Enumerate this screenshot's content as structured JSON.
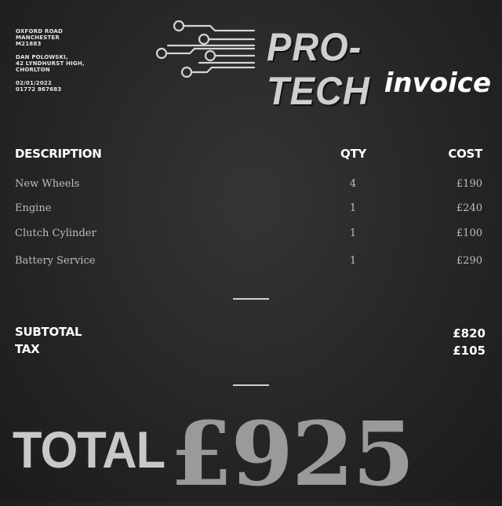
{
  "address": {
    "company": [
      "OXFORD ROAD",
      "MANCHESTER",
      "M21883"
    ],
    "customer": [
      "DAN POLOWSKI,",
      "42 LYNDHURST HIGH,",
      "CHORLTON"
    ],
    "meta": [
      "02/01/2022",
      "01772 867683"
    ]
  },
  "brand": {
    "name": "PRO-TECH",
    "doc_type": "invoice"
  },
  "table": {
    "headers": {
      "description": "DESCRIPTION",
      "qty": "QTY",
      "cost": "COST"
    },
    "rows": [
      {
        "description": "New Wheels",
        "qty": "4",
        "cost": "£190"
      },
      {
        "description": "Engine",
        "qty": "1",
        "cost": "£240"
      },
      {
        "description": "Clutch Cylinder",
        "qty": "1",
        "cost": "£100"
      },
      {
        "description": "Battery Service",
        "qty": "1",
        "cost": "£290"
      }
    ]
  },
  "summary": {
    "subtotal_label": "SUBTOTAL",
    "subtotal_value": "£820",
    "tax_label": "TAX",
    "tax_value": "£105"
  },
  "total": {
    "label": "TOTAL",
    "value": "£925"
  }
}
